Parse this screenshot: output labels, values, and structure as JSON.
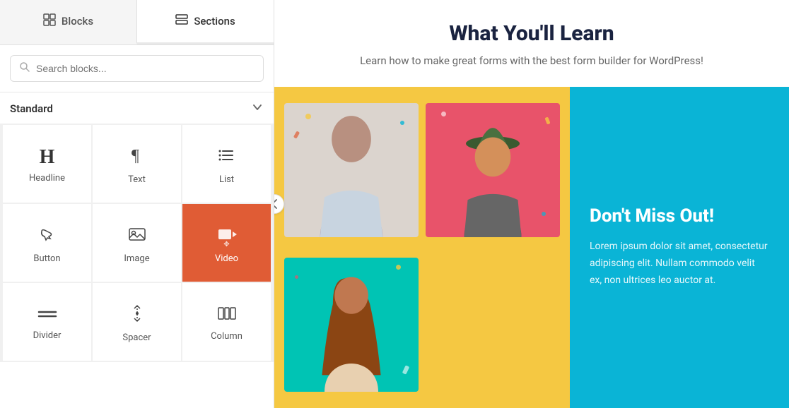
{
  "tabs": [
    {
      "id": "blocks",
      "label": "Blocks",
      "icon": "⊞",
      "active": false
    },
    {
      "id": "sections",
      "label": "Sections",
      "icon": "▤",
      "active": true
    }
  ],
  "search": {
    "placeholder": "Search blocks..."
  },
  "standard_section": {
    "title": "Standard",
    "chevron": "▾"
  },
  "blocks": [
    {
      "id": "headline",
      "label": "Headline",
      "icon": "H"
    },
    {
      "id": "text",
      "label": "Text",
      "icon": "¶"
    },
    {
      "id": "list",
      "label": "List",
      "icon": "list"
    },
    {
      "id": "button",
      "label": "Button",
      "icon": "☛"
    },
    {
      "id": "image",
      "label": "Image",
      "icon": "image"
    },
    {
      "id": "video",
      "label": "Video",
      "icon": "video",
      "selected": true
    },
    {
      "id": "divider",
      "label": "Divider",
      "icon": "divider"
    },
    {
      "id": "spacer",
      "label": "Spacer",
      "icon": "spacer"
    },
    {
      "id": "column",
      "label": "Column",
      "icon": "column"
    }
  ],
  "main_content": {
    "title": "What You'll Learn",
    "subtitle": "Learn how to make great forms with the best form builder for WordPress!",
    "dont_miss_title": "Don't Miss Out!",
    "dont_miss_body": "Lorem ipsum dolor sit amet, consectetur adipiscing elit. Nullam commodo velit ex, non ultrices leo auctor at.",
    "colors": {
      "yellow": "#f5c842",
      "blue": "#0ab4d6",
      "orange": "#e05c35",
      "dark_title": "#1a2340"
    }
  },
  "collapse_icon": "‹"
}
